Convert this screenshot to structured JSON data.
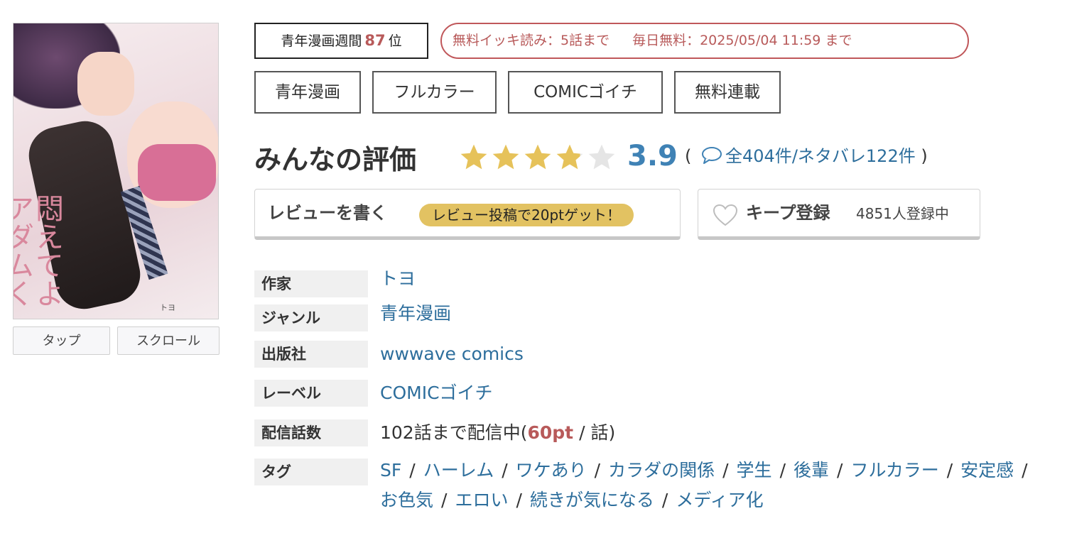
{
  "cover": {
    "title_art": "悶えてよアダムくん",
    "author_art": "トヨ"
  },
  "cover_buttons": {
    "tap": "タップ",
    "scroll": "スクロール"
  },
  "ranking": {
    "prefix": "青年漫画週間",
    "number": "87",
    "suffix": "位"
  },
  "free_info": {
    "ikki": "無料イッキ読み：5話まで",
    "daily": "毎日無料：2025/05/04 11:59 まで"
  },
  "genre_tags": [
    "青年漫画",
    "フルカラー",
    "COMICゴイチ",
    "無料連載"
  ],
  "rating": {
    "label": "みんなの評価",
    "score": "3.9",
    "stars_value": 3.9,
    "stars_max": 5,
    "open_paren": "(",
    "reviews_text": "全404件/ネタバレ122件",
    "close_paren": ")"
  },
  "review_button": {
    "label": "レビューを書く",
    "badge": "レビュー投稿で20ptゲット！"
  },
  "keep_button": {
    "label": "キープ登録",
    "count": "4851人登録中"
  },
  "info": {
    "author_label": "作家",
    "author": "トヨ",
    "genre_label": "ジャンル",
    "genre": "青年漫画",
    "publisher_label": "出版社",
    "publisher": "wwwave comics",
    "label_label": "レーベル",
    "label": "COMICゴイチ",
    "episodes_label": "配信話数",
    "episodes_prefix": "102話まで配信中(",
    "episodes_pt": "60pt",
    "episodes_suffix": " / 話)",
    "tags_label": "タグ",
    "tags": [
      "SF",
      "ハーレム",
      "ワケあり",
      "カラダの関係",
      "学生",
      "後輩",
      "フルカラー",
      "安定感",
      "お色気",
      "エロい",
      "続きが気になる",
      "メディア化"
    ],
    "tag_separator": "/"
  },
  "colors": {
    "link": "#2d6e9c",
    "accent_red": "#b85a5a",
    "star_on": "#e6c25a",
    "star_off": "#e5e5e5",
    "score": "#3f82b5",
    "badge": "#e2c262"
  }
}
